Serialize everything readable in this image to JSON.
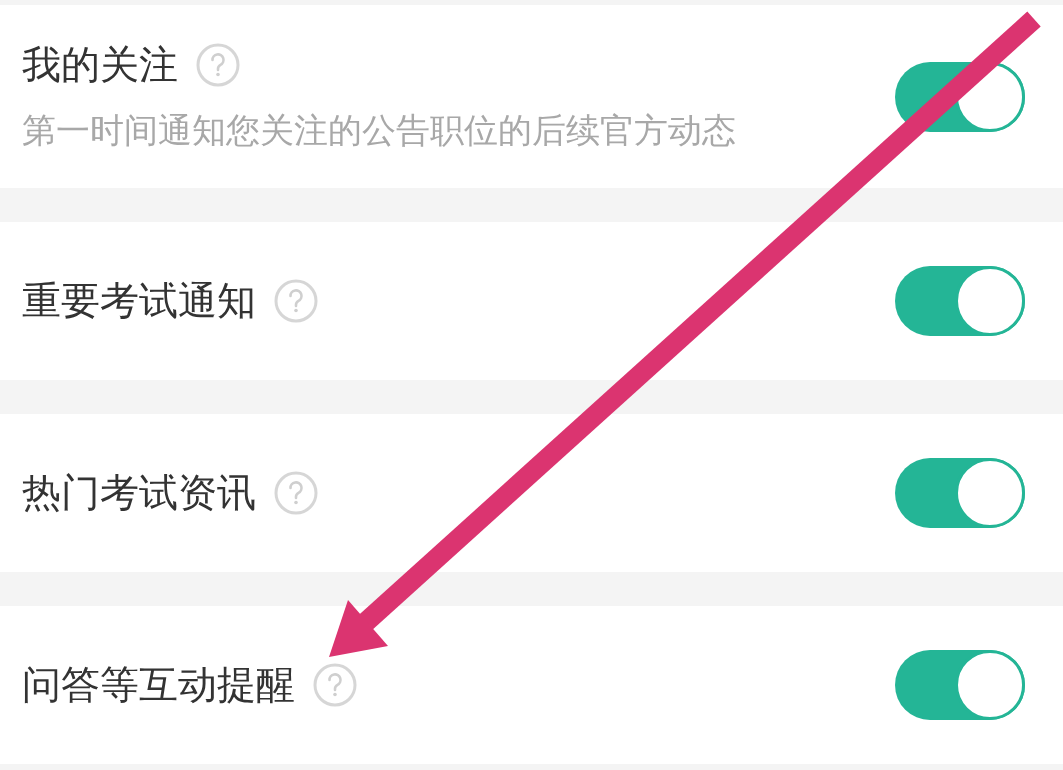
{
  "settings": [
    {
      "title": "我的关注",
      "subtitle": "第一时间通知您关注的公告职位的后续官方动态",
      "on": true
    },
    {
      "title": "重要考试通知",
      "on": true
    },
    {
      "title": "热门考试资讯",
      "on": true
    },
    {
      "title": "问答等互动提醒",
      "on": true
    }
  ],
  "annotations": [
    {
      "kind": "arrow"
    }
  ]
}
